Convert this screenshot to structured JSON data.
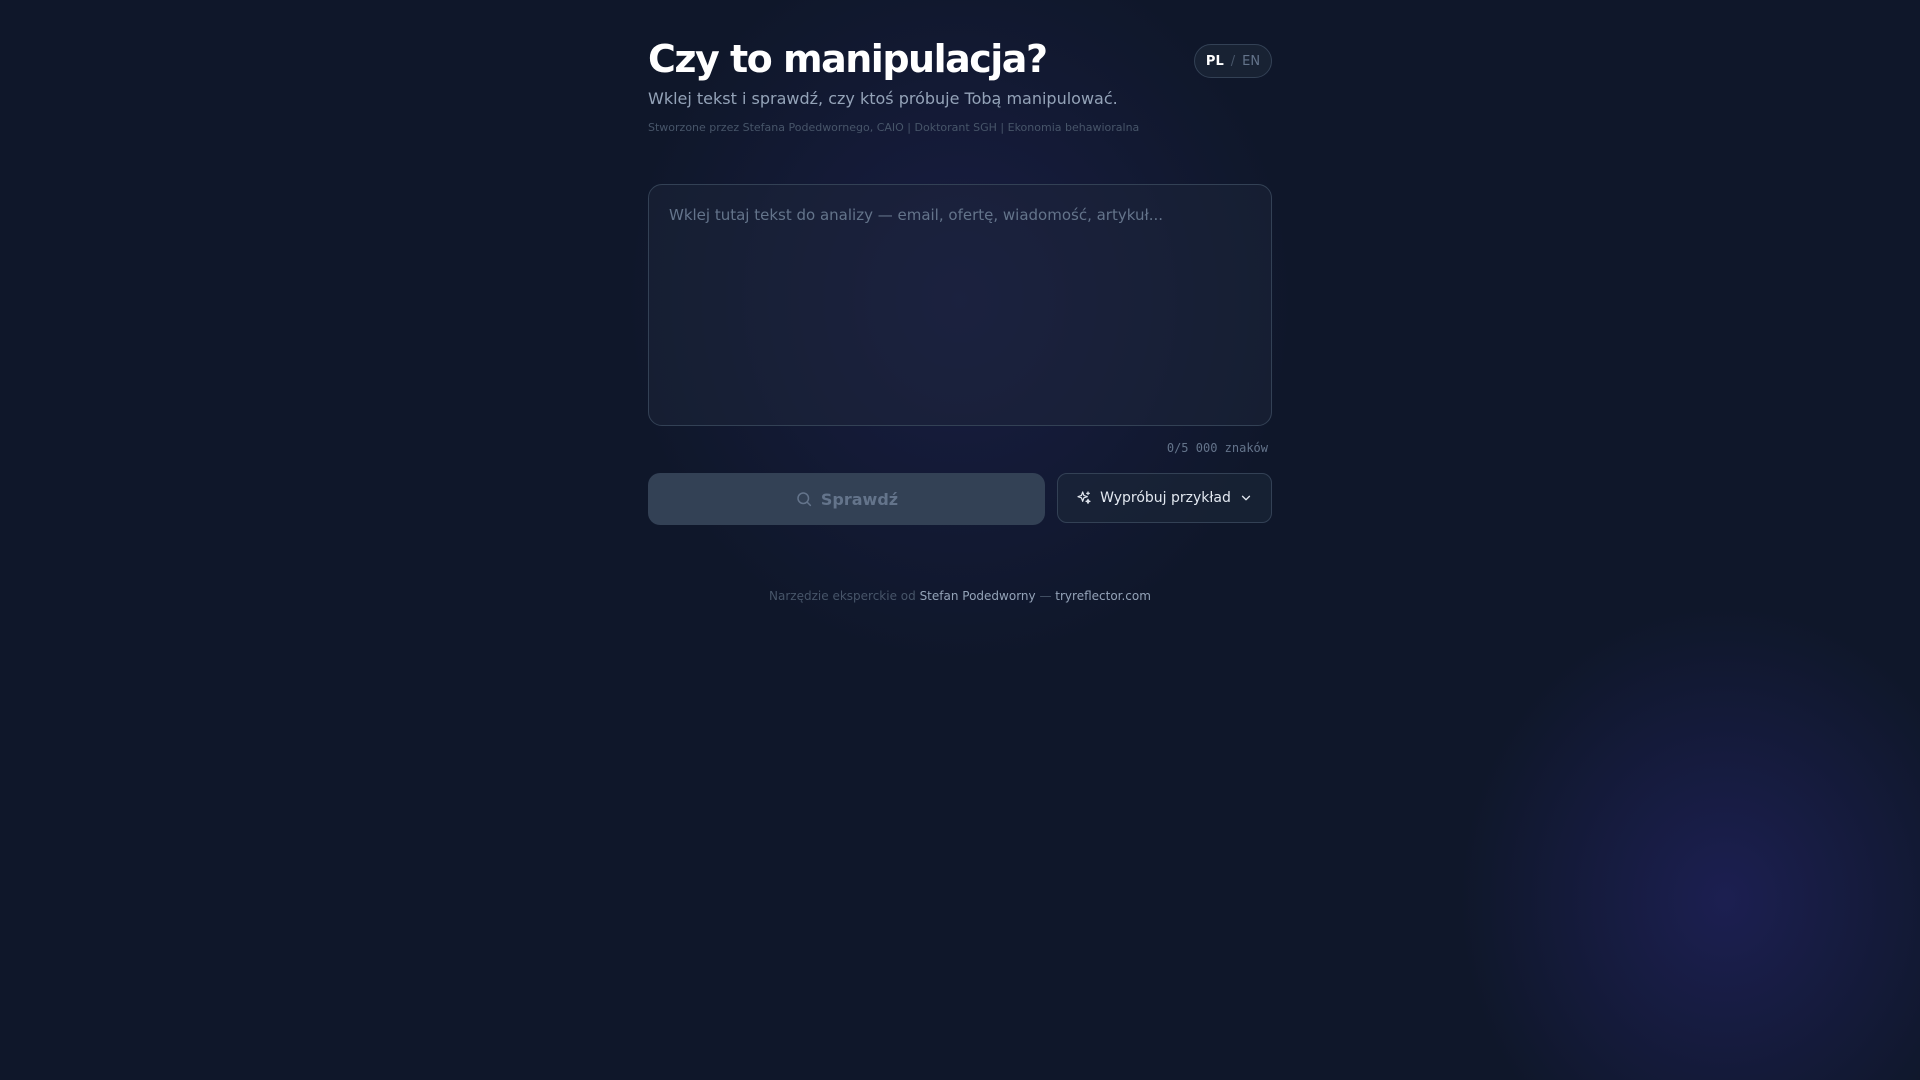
{
  "header": {
    "title": "Czy to manipulacja?",
    "subtitle": "Wklej tekst i sprawdź, czy ktoś próbuje Tobą manipulować.",
    "credits": "Stworzone przez Stefana Podedwornego, CAIO | Doktorant SGH | Ekonomia behawioralna"
  },
  "language_switch": {
    "active": "PL",
    "pl_label": "PL",
    "separator": "/",
    "en_label": "EN"
  },
  "analyzer": {
    "input_value": "",
    "input_placeholder": "Wklej tutaj tekst do analizy — email, ofertę, wiadomość, artykuł...",
    "char_count": "0/5 000 znaków",
    "check_label": "Sprawdź",
    "check_icon": "search-icon",
    "example_label": "Wypróbuj przykład",
    "example_icon": "sparkles-icon",
    "example_chevron": "chevron-down-icon"
  },
  "footer": {
    "prefix": "Narzędzie eksperckie od",
    "author_link": "Stefan Podedworny",
    "separator": "—",
    "site_link": "tryreflector.com"
  },
  "colors": {
    "background": "#0f172a",
    "surface": "#1e293b",
    "border": "#334155",
    "disabled_button": "#334155",
    "text_primary": "#ffffff",
    "text_muted": "#94a3b8"
  }
}
